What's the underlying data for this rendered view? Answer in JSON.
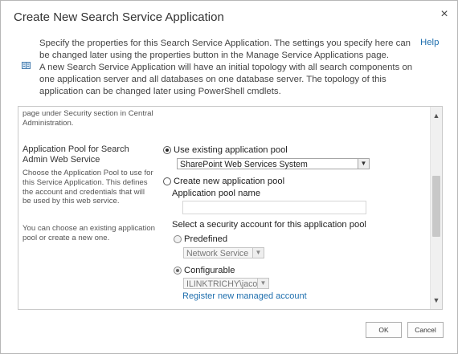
{
  "dialog": {
    "title": "Create New Search Service Application",
    "close_glyph": "×",
    "help_label": "Help",
    "intro_line1": "Specify the properties for this Search Service Application. The settings you specify here can be changed later using the properties button in the Manage Service Applications page.",
    "intro_line2": "A new Search Service Application will have an initial topology with all search components on one application server and all databases on one database server. The topology of this application can be changed later using PowerShell cmdlets."
  },
  "form": {
    "prev_desc": "page under Security section in Central Administration.",
    "app_pool": {
      "section_title": "Application Pool for Search Admin Web Service",
      "description": "Choose the Application Pool to use for this Service Application.  This defines the account and credentials that will be used by this web service.",
      "description2": "You can choose an existing application pool or create a new one.",
      "use_existing_label": "Use existing application pool",
      "use_existing_checked": true,
      "existing_pool_value": "SharePoint Web Services System",
      "create_new_label": "Create new application pool",
      "create_new_checked": false,
      "pool_name_label": "Application pool name",
      "pool_name_value": "",
      "security_account_label": "Select a security account for this application pool",
      "predefined_label": "Predefined",
      "predefined_checked": false,
      "predefined_value": "Network Service",
      "configurable_label": "Configurable",
      "configurable_checked": true,
      "configurable_value": "ILINKTRICHY\\jacob",
      "register_link": "Register new managed account"
    }
  },
  "buttons": {
    "ok_label": "OK",
    "cancel_label": "Cancel"
  },
  "icons": {
    "close": "close-icon",
    "info": "book-icon",
    "scroll_up": "chevron-up-icon",
    "scroll_down": "chevron-down-icon",
    "dropdown": "chevron-down-icon"
  },
  "colors": {
    "link": "#1f6fae",
    "backdrop": "#7a7a7a"
  }
}
